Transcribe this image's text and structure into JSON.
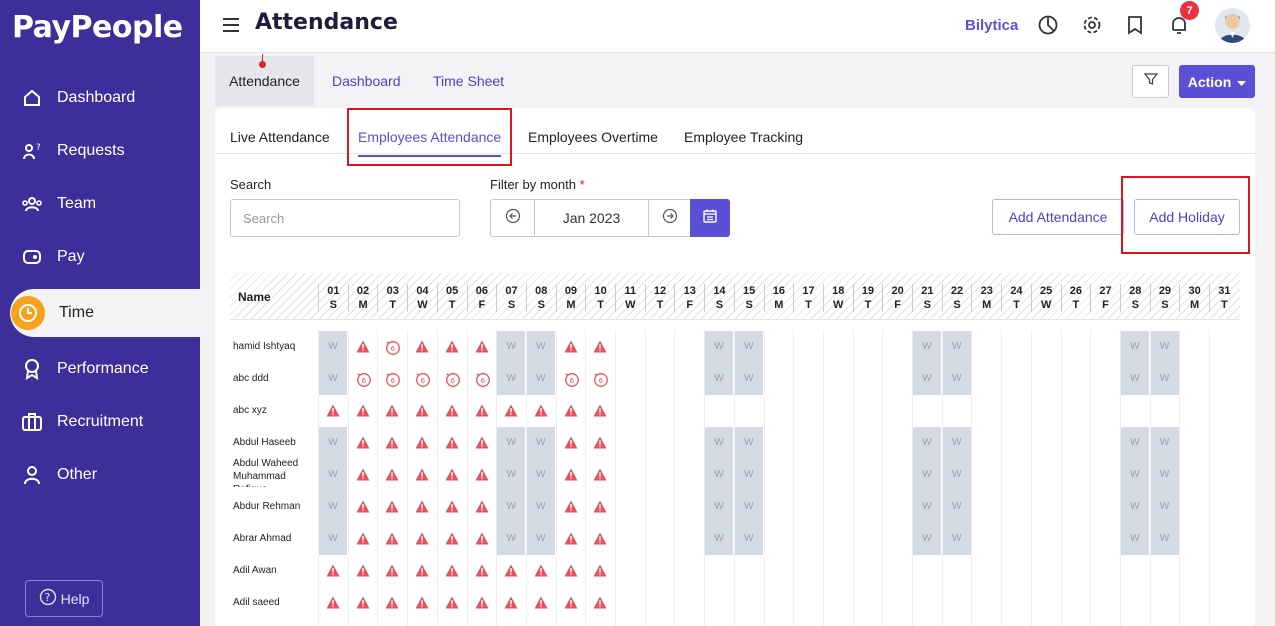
{
  "sidebar": {
    "logo": "PayPeople",
    "items": [
      {
        "label": "Dashboard",
        "icon": "home-icon"
      },
      {
        "label": "Requests",
        "icon": "requests-icon"
      },
      {
        "label": "Team",
        "icon": "team-icon"
      },
      {
        "label": "Pay",
        "icon": "wallet-icon"
      },
      {
        "label": "Time",
        "icon": "clock-icon"
      },
      {
        "label": "Performance",
        "icon": "award-icon"
      },
      {
        "label": "Recruitment",
        "icon": "briefcase-icon"
      },
      {
        "label": "Other",
        "icon": "user-icon"
      }
    ],
    "active": "Time",
    "help_label": "Help"
  },
  "header": {
    "title": "Attendance",
    "company": "Bilytica",
    "notification_count": "7"
  },
  "subnav": {
    "tabs": [
      "Attendance",
      "Dashboard",
      "Time Sheet"
    ],
    "action_label": "Action"
  },
  "card": {
    "tabs": [
      "Live Attendance",
      "Employees Attendance",
      "Employees Overtime",
      "Employee Tracking"
    ],
    "active_tab": "Employees Attendance",
    "search_label": "Search",
    "search_placeholder": "Search",
    "filter_label": "Filter by month",
    "filter_required": "*",
    "month_value": "Jan 2023",
    "add_attendance_label": "Add Attendance",
    "add_holiday_label": "Add Holiday"
  },
  "grid": {
    "name_header": "Name",
    "weekend_marker": "W",
    "days": [
      {
        "d": "01",
        "w": "S"
      },
      {
        "d": "02",
        "w": "M"
      },
      {
        "d": "03",
        "w": "T"
      },
      {
        "d": "04",
        "w": "W"
      },
      {
        "d": "05",
        "w": "T"
      },
      {
        "d": "06",
        "w": "F"
      },
      {
        "d": "07",
        "w": "S"
      },
      {
        "d": "08",
        "w": "S"
      },
      {
        "d": "09",
        "w": "M"
      },
      {
        "d": "10",
        "w": "T"
      },
      {
        "d": "11",
        "w": "W"
      },
      {
        "d": "12",
        "w": "T"
      },
      {
        "d": "13",
        "w": "F"
      },
      {
        "d": "14",
        "w": "S"
      },
      {
        "d": "15",
        "w": "S"
      },
      {
        "d": "16",
        "w": "M"
      },
      {
        "d": "17",
        "w": "T"
      },
      {
        "d": "18",
        "w": "W"
      },
      {
        "d": "19",
        "w": "T"
      },
      {
        "d": "20",
        "w": "F"
      },
      {
        "d": "21",
        "w": "S"
      },
      {
        "d": "22",
        "w": "S"
      },
      {
        "d": "23",
        "w": "M"
      },
      {
        "d": "24",
        "w": "T"
      },
      {
        "d": "25",
        "w": "W"
      },
      {
        "d": "26",
        "w": "T"
      },
      {
        "d": "27",
        "w": "F"
      },
      {
        "d": "28",
        "w": "S"
      },
      {
        "d": "29",
        "w": "S"
      },
      {
        "d": "30",
        "w": "M"
      },
      {
        "d": "31",
        "w": "T"
      }
    ],
    "rows": [
      {
        "name": "hamid Ishtyaq",
        "cells": "WAOAAAWWAA"
      },
      {
        "name": "abc ddd",
        "cells": "WOOOOOWWOO"
      },
      {
        "name": "abc xyz",
        "cells": "AAAAAAAAAA"
      },
      {
        "name": "Abdul Haseeb",
        "cells": "WAAAAAWWAA"
      },
      {
        "name": "Abdul Waheed Muhammad Rafique",
        "cells": "WAAAAAWWAA"
      },
      {
        "name": "Abdur Rehman",
        "cells": "WAAAAAWWAA"
      },
      {
        "name": "Abrar Ahmad",
        "cells": "WAAAAAWWAA"
      },
      {
        "name": "Adil Awan",
        "cells": "AAAAAAAAAA"
      },
      {
        "name": "Adil saeed",
        "cells": "AAAAAAAAAA"
      }
    ],
    "colors": {
      "absent": "#e8505b",
      "weekend": "#d4dbe5",
      "accent": "#5b4fd6"
    }
  }
}
